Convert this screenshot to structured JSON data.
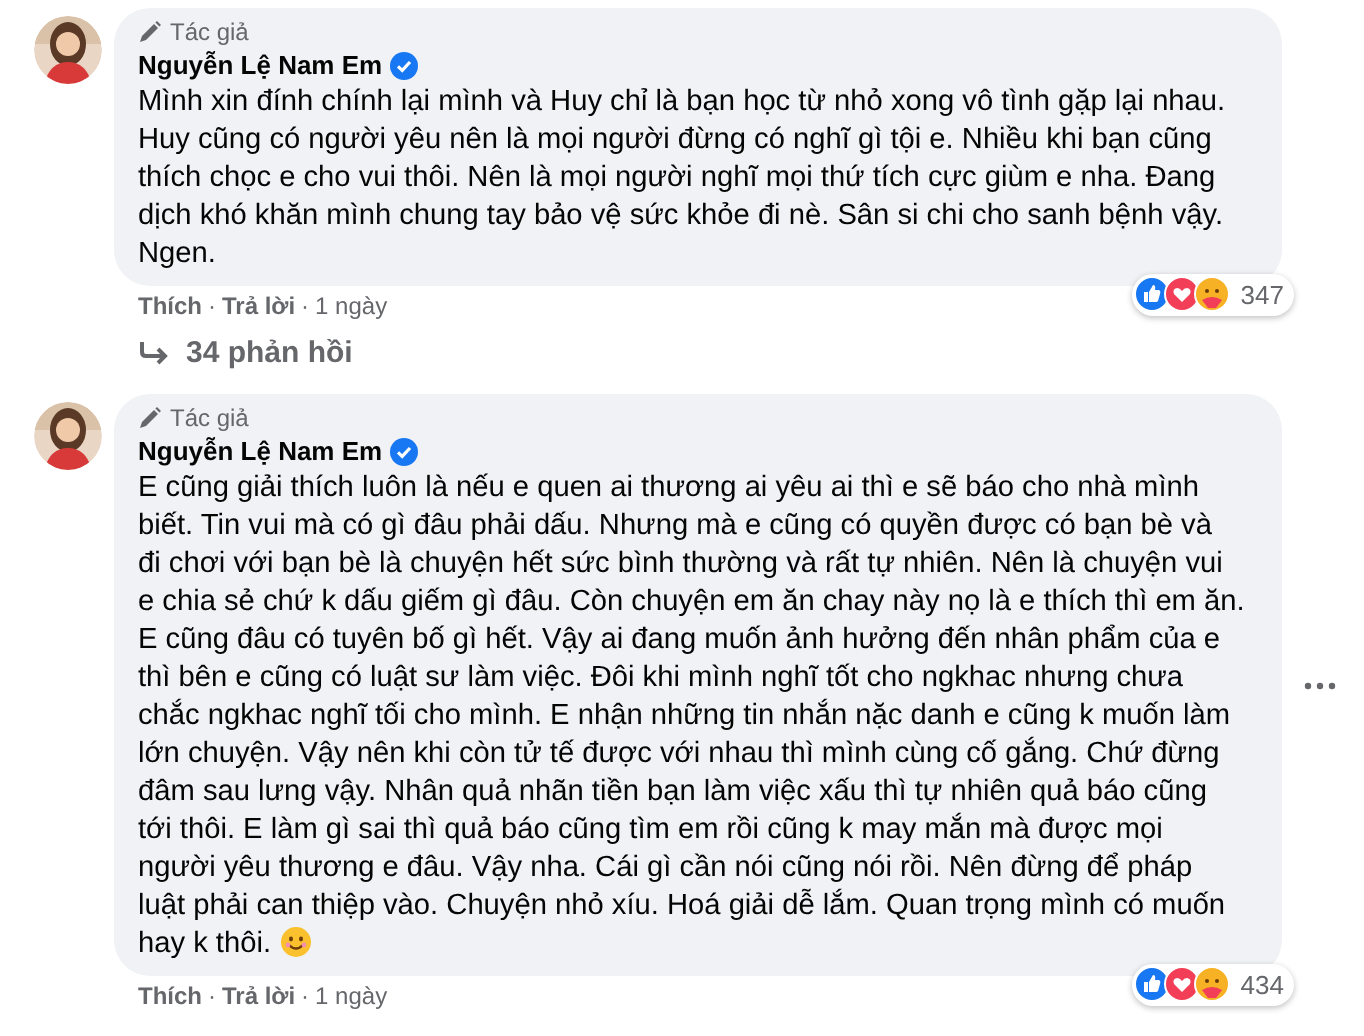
{
  "comments": [
    {
      "badge": "Tác giả",
      "author": "Nguyễn Lệ Nam Em",
      "verified": true,
      "lines": [
        "Mình xin đính chính lại mình và Huy chỉ là bạn học từ nhỏ xong vô tình gặp lại nhau.",
        "Huy cũng có người yêu nên là mọi người đừng có nghĩ gì tội e. Nhiều khi bạn cũng",
        "thích chọc e cho vui thôi. Nên là mọi người nghĩ mọi thứ tích cực giùm e nha. Đang",
        "dịch khó khăn mình chung tay bảo vệ sức khỏe đi nè. Sân si chi cho sanh bệnh vậy.",
        "Ngen."
      ],
      "smiley": false,
      "more_menu": false,
      "actions": [
        "Thích",
        "Trả lời"
      ],
      "separators": [
        "·",
        "·"
      ],
      "time": "1 ngày",
      "reaction_count": "347",
      "replies": "34 phản hồi"
    },
    {
      "badge": "Tác giả",
      "author": "Nguyễn Lệ Nam Em",
      "verified": true,
      "lines": [
        "E cũng giải thích luôn là nếu e quen ai thương ai yêu ai thì e sẽ báo cho nhà mình",
        "biết. Tin vui mà có gì đâu phải dấu. Nhưng mà e cũng có quyền được có bạn bè và",
        "đi chơi với bạn bè là chuyện hết sức bình thường và rất tự nhiên. Nên là chuyện vui",
        "e chia sẻ chứ k dấu giếm gì đâu. Còn chuyện em ăn chay này nọ là e thích thì em ăn.",
        "E cũng đâu có tuyên bố gì hết. Vậy ai đang muốn ảnh hưởng đến nhân phẩm của e",
        "thì bên e cũng có luật sư làm việc. Đôi khi mình nghĩ tốt cho ngkhac nhưng chưa",
        "chắc ngkhac nghĩ tối cho mình. E nhận những tin nhắn nặc danh e cũng k muốn làm",
        "lớn chuyện. Vậy nên khi còn tử tế được với nhau thì mình cùng cố gắng. Chứ đừng",
        "đâm sau lưng vậy. Nhân quả nhãn tiền bạn làm việc xấu thì tự nhiên quả báo cũng",
        "tới thôi. E làm gì sai thì quả báo cũng tìm em rồi cũng k may mắn mà được mọi",
        "người yêu thương e đâu. Vậy nha. Cái gì cần nói cũng nói rồi. Nên đừng để pháp",
        "luật phải can thiệp vào. Chuyện nhỏ xíu. Hoá giải dễ lắm. Quan trọng mình có muốn",
        "hay k thôi."
      ],
      "smiley": true,
      "more_menu": true,
      "actions": [
        "Thích",
        "Trả lời"
      ],
      "separators": [
        "·",
        "·"
      ],
      "time": "1 ngày",
      "reaction_count": "434"
    }
  ]
}
